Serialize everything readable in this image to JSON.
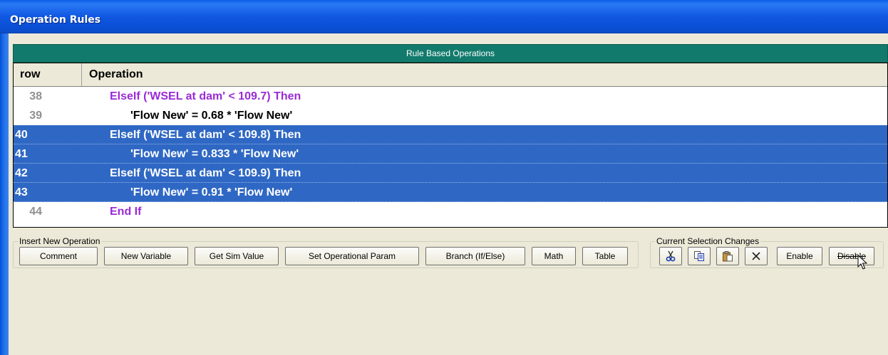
{
  "window": {
    "title": "Operation Rules"
  },
  "header": {
    "title": "Rule Based Operations"
  },
  "table": {
    "columns": [
      "row",
      "Operation"
    ],
    "rows": [
      {
        "num": "38",
        "text": "ElseIf ('WSEL at dam' < 109.7) Then",
        "selected": false,
        "kind": "keyword"
      },
      {
        "num": "39",
        "text": "'Flow New' = 0.68 * 'Flow New'",
        "selected": false,
        "kind": "statement"
      },
      {
        "num": "40",
        "text": "ElseIf ('WSEL at dam' < 109.8) Then",
        "selected": true,
        "kind": "keyword"
      },
      {
        "num": "41",
        "text": "'Flow New' = 0.833 * 'Flow New'",
        "selected": true,
        "kind": "statement"
      },
      {
        "num": "42",
        "text": "ElseIf ('WSEL at dam' < 109.9) Then",
        "selected": true,
        "kind": "keyword"
      },
      {
        "num": "43",
        "text": "'Flow New' = 0.91 * 'Flow New'",
        "selected": true,
        "kind": "statement"
      },
      {
        "num": "44",
        "text": "End If",
        "selected": false,
        "kind": "keyword"
      }
    ]
  },
  "insert_group": {
    "label": "Insert New Operation",
    "buttons": [
      "Comment",
      "New Variable",
      "Get Sim Value",
      "Set Operational Param",
      "Branch (If/Else)",
      "Math",
      "Table"
    ]
  },
  "selection_group": {
    "label": "Current Selection Changes",
    "icons": [
      "cut-icon",
      "copy-icon",
      "paste-icon",
      "delete-icon"
    ],
    "enable_label": "Enable",
    "disable_label": "Disable"
  },
  "colors": {
    "selection": "#2f68c4",
    "header_bar": "#117a6c",
    "keyword": "#9a2bd6",
    "titlebar": "#0a4fd6"
  }
}
